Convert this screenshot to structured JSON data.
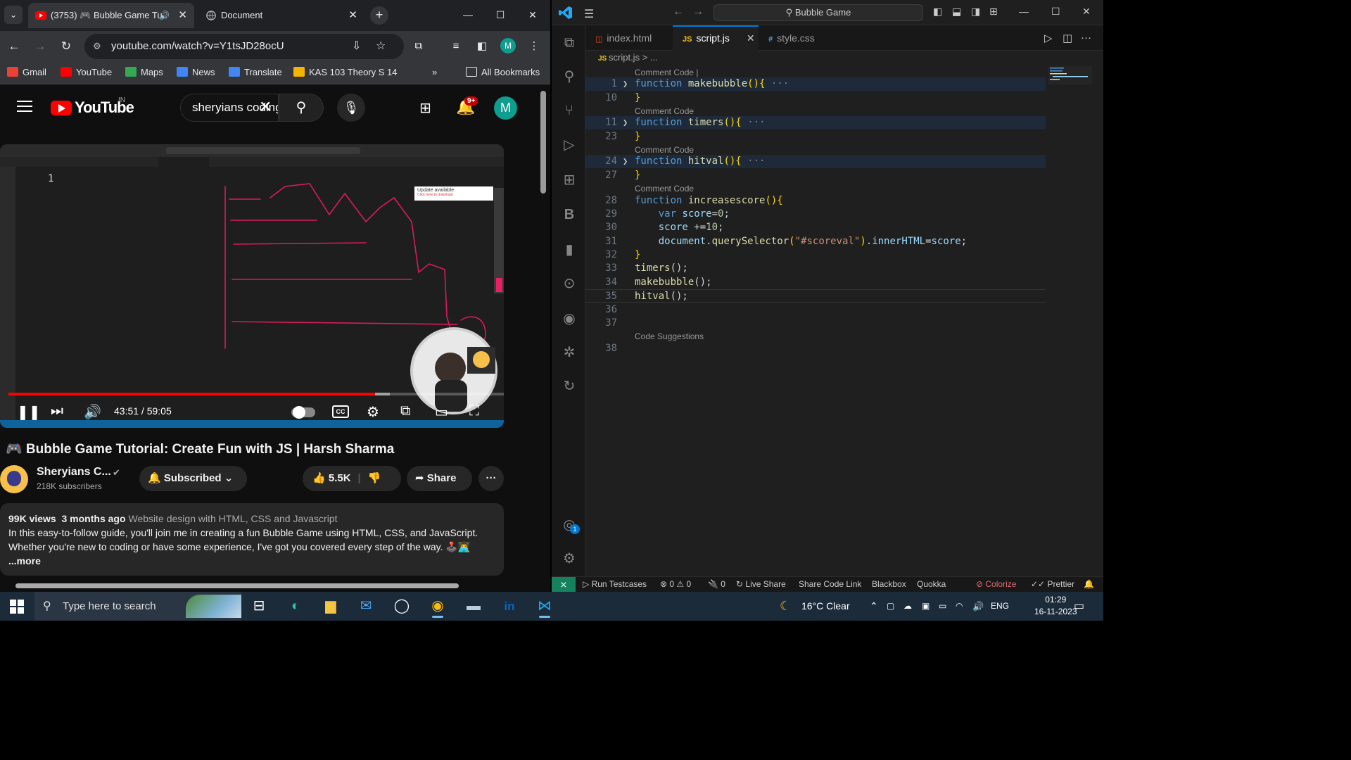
{
  "browser": {
    "tab_active_title": "(3753) 🎮 Bubble Game Tu",
    "tab_inactive_title": "Document",
    "url": "youtube.com/watch?v=Y1tsJD28ocU",
    "avatar_letter": "M",
    "bookmarks": [
      "Gmail",
      "YouTube",
      "Maps",
      "News",
      "Translate",
      "KAS 103 Theory S 14"
    ],
    "all_bookmarks": "All Bookmarks"
  },
  "youtube": {
    "logo_text": "YouTube",
    "region": "IN",
    "search_query": "sheryians coding",
    "notification_count": "9+",
    "avatar_letter": "M",
    "player": {
      "inner_line_number": "1",
      "update_tip": "Update available",
      "update_tip_sub": "Click here to download",
      "time_current": "43:51",
      "time_total": "59:05",
      "timecode": "43:51 / 59:05",
      "progress_fraction": 0.74,
      "buffered_fraction": 0.77
    },
    "video_title": "🎮 Bubble Game Tutorial: Create Fun with JS | Harsh Sharma",
    "channel_name": "Sheryians C...",
    "subscribers": "218K subscribers",
    "subscribed_label": "Subscribed",
    "likes": "5.5K",
    "share_label": "Share",
    "views": "99K views",
    "age": "3 months ago",
    "category": "Website design with HTML, CSS and Javascript",
    "description_line1": "In this easy-to-follow guide, you'll join me in creating a fun Bubble Game using HTML, CSS, and JavaScript.",
    "description_line2": "Whether you're new to coding or have some experience, I've got you covered every step of the way. 🕹️👨‍💻",
    "more_label": "...more"
  },
  "vscode": {
    "command_center": "Bubble Game",
    "tabs": [
      {
        "label": "index.html",
        "icon": "html-file-icon",
        "color": "#e44d26"
      },
      {
        "label": "script.js",
        "icon": "js-file-icon",
        "color": "#f1c40f"
      },
      {
        "label": "style.css",
        "icon": "css-file-icon",
        "color": "#42a5f5"
      }
    ],
    "breadcrumb_file": "script.js",
    "breadcrumb_rest": "> ...",
    "code_lens_first": "Comment Code |",
    "code_lens": "Comment Code",
    "code_suggestions": "Code Suggestions",
    "lines": [
      {
        "n": "1",
        "text": "function makebubble(){ ···"
      },
      {
        "n": "10",
        "text": "}"
      },
      {
        "n": "11",
        "text": "function timers(){ ···"
      },
      {
        "n": "23",
        "text": "}"
      },
      {
        "n": "24",
        "text": "function hitval(){ ···"
      },
      {
        "n": "27",
        "text": "}"
      },
      {
        "n": "28",
        "text": "function increasescore(){"
      },
      {
        "n": "29",
        "text": "    var score=0;"
      },
      {
        "n": "30",
        "text": "    score +=10;"
      },
      {
        "n": "31",
        "text": "    document.querySelector(\"#scoreval\").innerHTML=score;"
      },
      {
        "n": "32",
        "text": "}"
      },
      {
        "n": "33",
        "text": "timers();"
      },
      {
        "n": "34",
        "text": "makebubble();"
      },
      {
        "n": "35",
        "text": "hitval();"
      },
      {
        "n": "36",
        "text": ""
      },
      {
        "n": "37",
        "text": ""
      },
      {
        "n": "38",
        "text": ""
      }
    ],
    "accounts_badge": "1",
    "status": {
      "run_testcases": "Run Testcases",
      "problems": "⊗ 0 ⚠ 0",
      "ports": "🔌 0",
      "live_share": "Live Share",
      "share_code_link": "Share Code Link",
      "blackbox": "Blackbox",
      "quokka": "Quokka",
      "colorize": "Colorize",
      "prettier": "Prettier"
    }
  },
  "taskbar": {
    "search_placeholder": "Type here to search",
    "weather": "16°C  Clear",
    "language": "ENG",
    "time": "01:29",
    "date": "16-11-2023"
  }
}
